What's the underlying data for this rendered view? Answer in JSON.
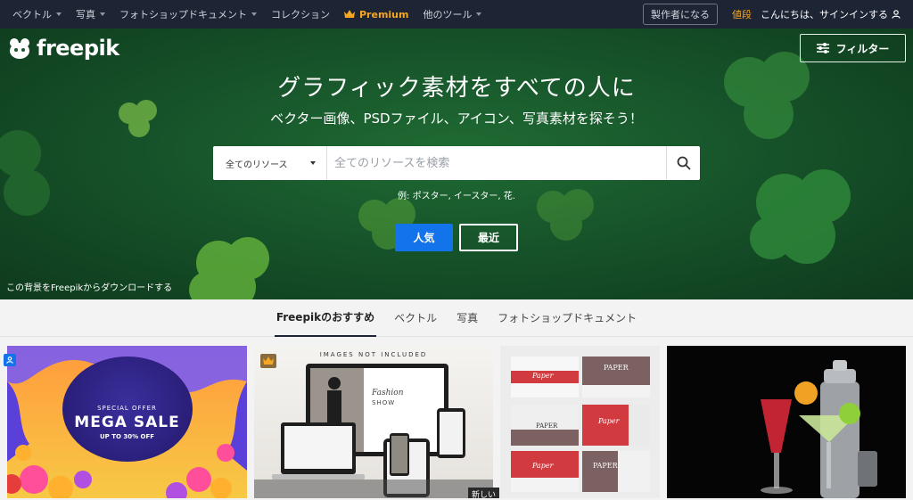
{
  "topnav": {
    "items": [
      {
        "label": "ベクトル",
        "dropdown": true
      },
      {
        "label": "写真",
        "dropdown": true
      },
      {
        "label": "フォトショップドキュメント",
        "dropdown": true
      },
      {
        "label": "コレクション",
        "dropdown": false
      }
    ],
    "premium_label": "Premium",
    "other_tools_label": "他のツール",
    "contributor_label": "製作者になる",
    "pricing_label": "値段",
    "signin_label": "こんにちは、サインインする"
  },
  "hero": {
    "logo_text": "freepik",
    "filter_label": "フィルター",
    "title": "グラフィック素材をすべての人に",
    "subtitle": "ベクター画像、PSDファイル、アイコン、写真素材を探そう！",
    "search_select_value": "全てのリソース",
    "search_placeholder": "全てのリソースを検索",
    "examples": "例: ポスター, イースター, 花.",
    "popular_label": "人気",
    "recent_label": "最近",
    "credit": "この背景をFreepikからダウンロードする"
  },
  "tabs": [
    {
      "label": "Freepikのおすすめ",
      "active": true
    },
    {
      "label": "ベクトル",
      "active": false
    },
    {
      "label": "写真",
      "active": false
    },
    {
      "label": "フォトショップドキュメント",
      "active": false
    }
  ],
  "cards": {
    "card1": {
      "special_offer": "SPECIAL OFFER",
      "title": "MEGA SALE",
      "discount": "UP TO 30% OFF"
    },
    "card2": {
      "banner": "IMAGES NOT INCLUDED",
      "fashion": "Fashion",
      "show": "SHOW",
      "new_label": "新しい"
    },
    "card3": {
      "paper_label": "PAPER",
      "paper_script": "Paper"
    }
  },
  "colors": {
    "topnav_bg": "#1d2434",
    "accent_orange": "#f5a623",
    "primary_blue": "#1273eb",
    "hero_green": "#17542a"
  }
}
